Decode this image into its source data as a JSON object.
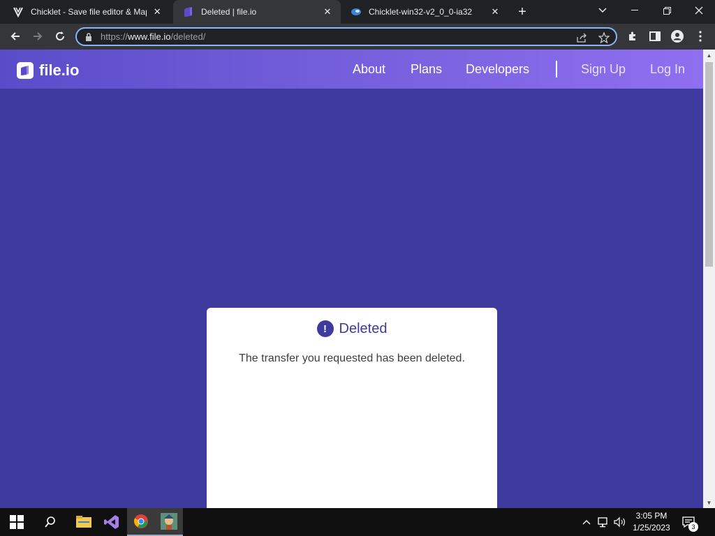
{
  "browser": {
    "tabs": [
      {
        "title": "Chicklet - Save file editor & Map",
        "icon": "chicklet-favicon-icon",
        "active": false
      },
      {
        "title": "Deleted | file.io",
        "icon": "fileio-favicon-icon",
        "active": true
      },
      {
        "title": "Chicklet-win32-v2_0_0-ia32",
        "icon": "chicklet-release-favicon-icon",
        "active": false
      }
    ],
    "new_tab_label": "+",
    "url_scheme": "https://",
    "url_host": "www.file.io",
    "url_path": "/deleted/"
  },
  "site": {
    "logo_text": "file.io",
    "nav": {
      "about": "About",
      "plans": "Plans",
      "developers": "Developers",
      "signup": "Sign Up",
      "login": "Log In"
    }
  },
  "card": {
    "alert_symbol": "!",
    "title": "Deleted",
    "message": "The transfer you requested has been deleted."
  },
  "taskbar": {
    "time": "3:05 PM",
    "date": "1/25/2023",
    "notification_count": "3"
  },
  "colors": {
    "page_background": "#3f3a9e",
    "nav_gradient_start": "#5a4cc9",
    "nav_gradient_end": "#8f6ff0",
    "accent": "#3f3a9e"
  }
}
